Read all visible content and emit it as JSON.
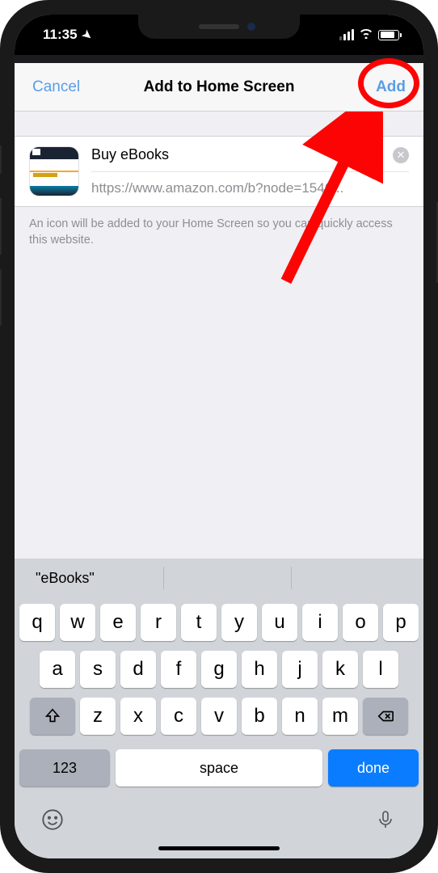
{
  "status": {
    "time": "11:35"
  },
  "header": {
    "cancel": "Cancel",
    "title": "Add to Home Screen",
    "add": "Add"
  },
  "form": {
    "name": "Buy eBooks",
    "url": "https://www.amazon.com/b?node=1546..."
  },
  "helper": "An icon will be added to your Home Screen so you can quickly access this website.",
  "keyboard": {
    "suggestion1": "\"eBooks\"",
    "row1": [
      "q",
      "w",
      "e",
      "r",
      "t",
      "y",
      "u",
      "i",
      "o",
      "p"
    ],
    "row2": [
      "a",
      "s",
      "d",
      "f",
      "g",
      "h",
      "j",
      "k",
      "l"
    ],
    "row3": [
      "z",
      "x",
      "c",
      "v",
      "b",
      "n",
      "m"
    ],
    "num": "123",
    "space": "space",
    "done": "done"
  }
}
